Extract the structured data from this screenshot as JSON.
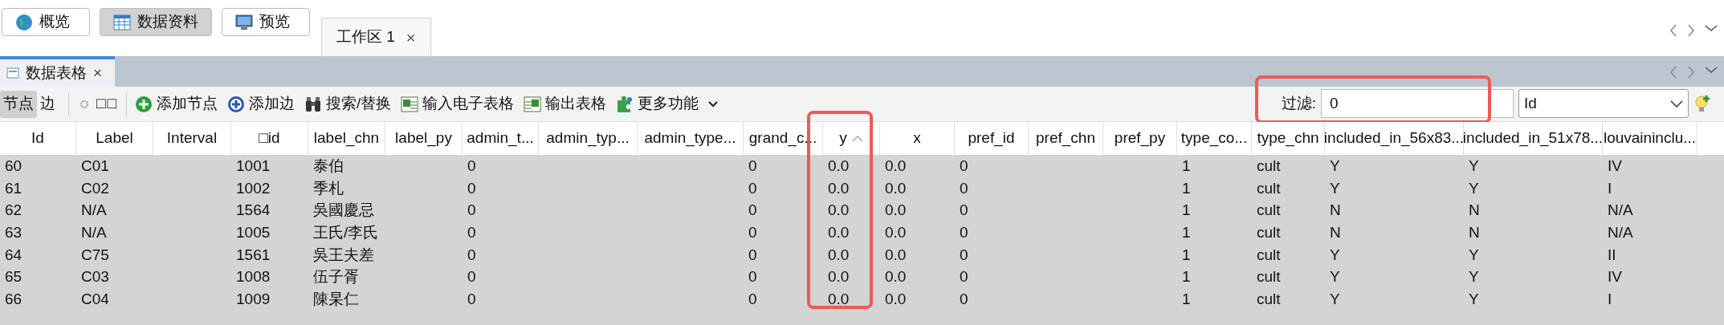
{
  "perspectives": [
    {
      "label": "概览",
      "selected": false
    },
    {
      "label": "数据资料",
      "selected": true
    },
    {
      "label": "预览",
      "selected": false
    }
  ],
  "workspace_tabs": [
    {
      "label": "工作区 1",
      "close": "×"
    }
  ],
  "panel_tabs": [
    {
      "label": "数据表格",
      "close": "×"
    }
  ],
  "toolbar": {
    "modes": [
      {
        "label": "节点",
        "selected": true
      },
      {
        "label": "边",
        "selected": false
      }
    ],
    "glyph_button": "□□",
    "actions": [
      {
        "label": "添加节点"
      },
      {
        "label": "添加边"
      },
      {
        "label": "搜索/替换"
      },
      {
        "label": "输入电子表格"
      },
      {
        "label": "输出表格"
      },
      {
        "label": "更多功能"
      }
    ],
    "filter": {
      "label": "过滤:",
      "value": "0",
      "highlighted": true,
      "column": "Id"
    }
  },
  "table": {
    "columns": [
      {
        "label": "Id",
        "sorted": false,
        "highlighted": false
      },
      {
        "label": "Label",
        "sorted": false,
        "highlighted": false
      },
      {
        "label": "Interval",
        "sorted": false,
        "highlighted": false
      },
      {
        "label": "□id",
        "sorted": false,
        "highlighted": false
      },
      {
        "label": "label_chn",
        "sorted": false,
        "highlighted": false
      },
      {
        "label": "label_py",
        "sorted": false,
        "highlighted": false
      },
      {
        "label": "admin_t...",
        "sorted": false,
        "highlighted": false
      },
      {
        "label": "admin_typ...",
        "sorted": false,
        "highlighted": false
      },
      {
        "label": "admin_type...",
        "sorted": false,
        "highlighted": false
      },
      {
        "label": "grand_c...",
        "sorted": false,
        "highlighted": false
      },
      {
        "label": "y",
        "sorted": true,
        "highlighted": true
      },
      {
        "label": "x",
        "sorted": false,
        "highlighted": false
      },
      {
        "label": "pref_id",
        "sorted": false,
        "highlighted": false
      },
      {
        "label": "pref_chn",
        "sorted": false,
        "highlighted": false
      },
      {
        "label": "pref_py",
        "sorted": false,
        "highlighted": false
      },
      {
        "label": "type_co...",
        "sorted": false,
        "highlighted": false
      },
      {
        "label": "type_chn",
        "sorted": false,
        "highlighted": false
      },
      {
        "label": "included_in_56x83...",
        "sorted": false,
        "highlighted": false
      },
      {
        "label": "included_in_51x78...",
        "sorted": false,
        "highlighted": false
      },
      {
        "label": "louvaininclu...",
        "sorted": false,
        "highlighted": false
      }
    ],
    "rows": [
      {
        "cells": [
          "60",
          "C01",
          null,
          "1001",
          "泰伯",
          null,
          "0",
          null,
          null,
          "0",
          "0.0",
          "0.0",
          "0",
          null,
          null,
          "1",
          "cult",
          "Y",
          "Y",
          "IV"
        ]
      },
      {
        "cells": [
          "61",
          "C02",
          null,
          "1002",
          "季札",
          null,
          "0",
          null,
          null,
          "0",
          "0.0",
          "0.0",
          "0",
          null,
          null,
          "1",
          "cult",
          "Y",
          "Y",
          "I"
        ]
      },
      {
        "cells": [
          "62",
          "N/A",
          null,
          "1564",
          "吳國慶忌",
          null,
          "0",
          null,
          null,
          "0",
          "0.0",
          "0.0",
          "0",
          null,
          null,
          "1",
          "cult",
          "N",
          "N",
          "N/A"
        ]
      },
      {
        "cells": [
          "63",
          "N/A",
          null,
          "1005",
          "王氏/李氏",
          null,
          "0",
          null,
          null,
          "0",
          "0.0",
          "0.0",
          "0",
          null,
          null,
          "1",
          "cult",
          "N",
          "N",
          "N/A"
        ]
      },
      {
        "cells": [
          "64",
          "C75",
          null,
          "1561",
          "吳王夫差",
          null,
          "0",
          null,
          null,
          "0",
          "0.0",
          "0.0",
          "0",
          null,
          null,
          "1",
          "cult",
          "Y",
          "Y",
          "II"
        ]
      },
      {
        "cells": [
          "65",
          "C03",
          null,
          "1008",
          "伍子胥",
          null,
          "0",
          null,
          null,
          "0",
          "0.0",
          "0.0",
          "0",
          null,
          null,
          "1",
          "cult",
          "Y",
          "Y",
          "IV"
        ]
      },
      {
        "cells": [
          "66",
          "C04",
          null,
          "1009",
          "陳杲仁",
          null,
          "0",
          null,
          null,
          "0",
          "0.0",
          "0.0",
          "0",
          null,
          null,
          "1",
          "cult",
          "Y",
          "Y",
          "I"
        ]
      }
    ]
  }
}
